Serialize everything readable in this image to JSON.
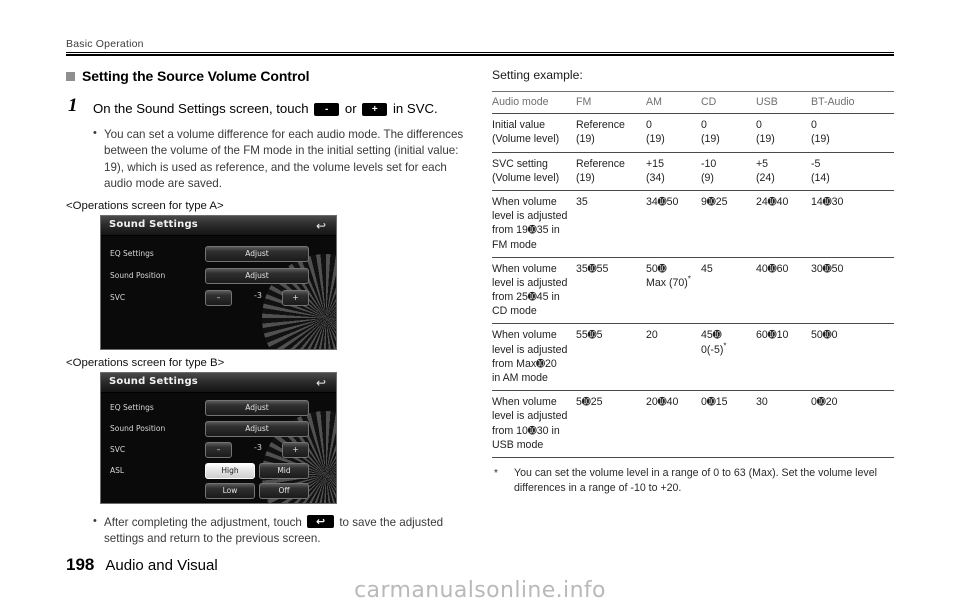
{
  "header": {
    "running_head": "Basic Operation"
  },
  "section": {
    "title": "Setting the Source Volume Control"
  },
  "step": {
    "number": "1",
    "text_before": "On the Sound Settings screen, touch",
    "key_minus": "-",
    "text_middle": "or",
    "key_plus": "+",
    "text_after": "in SVC."
  },
  "bullets": [
    "You can set a volume difference for each audio mode. The differences between the volume of the FM mode in the initial setting (initial value: 19), which is used as reference, and the volume levels set for each audio mode are saved."
  ],
  "captions": {
    "type_a": "<Operations screen for type A>",
    "type_b": "<Operations screen for type B>"
  },
  "screen_a": {
    "title": "Sound Settings",
    "back_icon": "back-arrow-icon",
    "rows": [
      {
        "label": "EQ Settings",
        "button": "Adjust"
      },
      {
        "label": "Sound Position",
        "button": "Adjust"
      },
      {
        "label": "SVC",
        "minus": "–",
        "value": "-3",
        "plus": "+"
      }
    ]
  },
  "screen_b": {
    "title": "Sound Settings",
    "back_icon": "back-arrow-icon",
    "rows": [
      {
        "label": "EQ Settings",
        "button": "Adjust"
      },
      {
        "label": "Sound Position",
        "button": "Adjust"
      },
      {
        "label": "SVC",
        "minus": "–",
        "value": "-3",
        "plus": "+"
      },
      {
        "label": "ASL",
        "opt1": "High",
        "opt2": "Mid",
        "opt3": "Low",
        "opt4": "Off",
        "selected": "High"
      }
    ]
  },
  "final_bullet": {
    "text_before": "After completing the adjustment, touch",
    "key_back": "↶",
    "text_after": "to save the adjusted settings and return to the previous screen."
  },
  "right": {
    "setting_example_label": "Setting example:",
    "table": {
      "columns": [
        "Audio mode",
        "FM",
        "AM",
        "CD",
        "USB",
        "BT-Audio"
      ],
      "rows": [
        {
          "mode": "Initial value\n(Volume level)",
          "fm": "Reference\n(19)",
          "am": "0\n(19)",
          "cd": "0\n(19)",
          "usb": "0\n(19)",
          "bt": "0\n(19)"
        },
        {
          "mode": "SVC setting\n(Volume level)",
          "fm": "Reference\n(19)",
          "am": "+15\n(34)",
          "cd": "-10\n(9)",
          "usb": "+5\n(24)",
          "bt": "-5\n(14)"
        },
        {
          "mode": "When volume\nlevel is adjusted\nfrom 19➓35 in\nFM mode",
          "fm": "35",
          "am": "34➓50",
          "cd": "9➓25",
          "usb": "24➓40",
          "bt": "14➓30"
        },
        {
          "mode": "When volume\nlevel is adjusted\nfrom 25➓45 in\nCD mode",
          "fm": "35➓55",
          "am": "50➓\nMax (70)",
          "am_footnote": "*",
          "cd": "45",
          "usb": "40➓60",
          "bt": "30➓50"
        },
        {
          "mode": "When volume\nlevel is adjusted\nfrom Max➓20\nin AM mode",
          "fm": "55➓5",
          "am": "20",
          "cd": "45➓\n0(-5)",
          "cd_footnote": "*",
          "usb": "60➓10",
          "bt": "50➓0"
        },
        {
          "mode": "When volume\nlevel is adjusted\nfrom 10➓30 in\nUSB mode",
          "fm": "5➓25",
          "am": "20➓40",
          "cd": "0➓15",
          "usb": "30",
          "bt": "0➓20"
        }
      ]
    },
    "footnote": {
      "marker": "*",
      "text": "You can set the volume level in a range of 0 to 63 (Max). Set the volume level differences in a range of -10 to +20."
    }
  },
  "footer": {
    "page_number": "198",
    "page_title": "Audio and Visual",
    "watermark": "carmanualsonline.info"
  }
}
